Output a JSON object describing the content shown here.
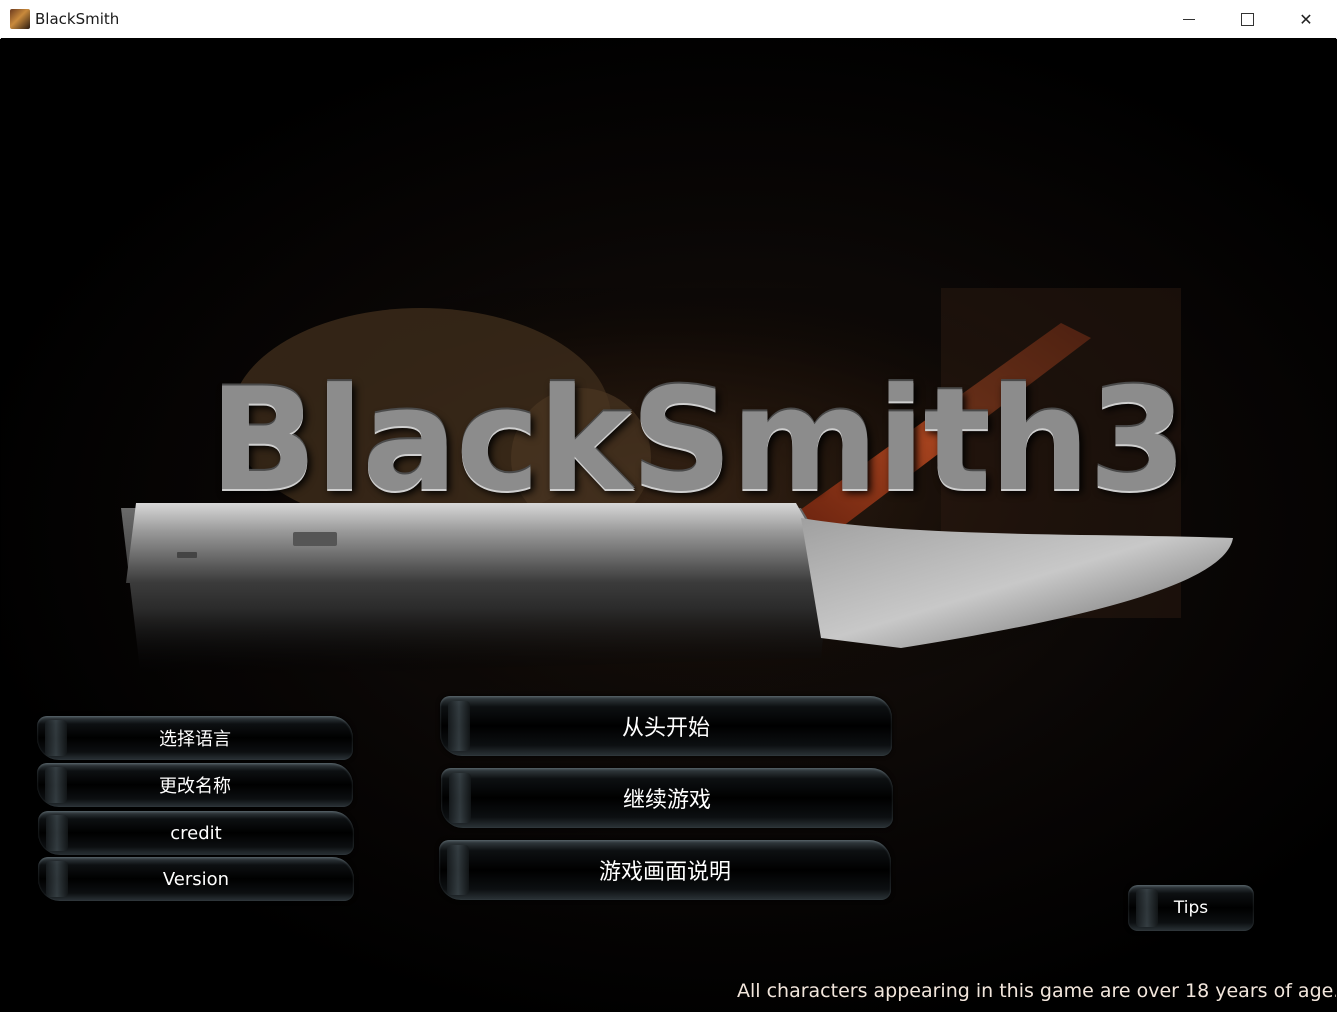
{
  "window": {
    "title": "BlackSmith"
  },
  "title_controls": {
    "minimize": "minimize",
    "maximize": "maximize",
    "close": "✕"
  },
  "logo": {
    "text": "BlackSmith3",
    "icon": "anvil-logo"
  },
  "side_menu": {
    "select_language": "选择语言",
    "change_name": "更改名称",
    "credit": "credit",
    "version": "Version"
  },
  "main_menu": {
    "new_game": "从头开始",
    "continue": "继续游戏",
    "screen_guide": "游戏画面说明"
  },
  "tips_button": "Tips",
  "disclaimer": "All characters appearing in this game are over 18 years of age."
}
